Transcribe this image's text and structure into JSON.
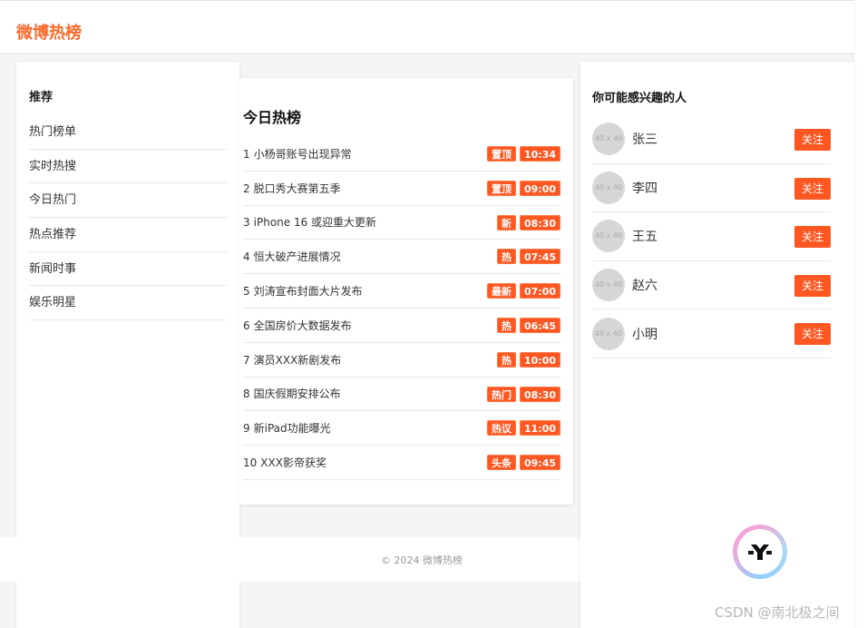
{
  "header": {
    "logo": "微博热榜"
  },
  "left": {
    "title": "推荐",
    "items": [
      "热门榜单",
      "实时热搜",
      "今日热门",
      "热点推荐",
      "新闻时事",
      "娱乐明星"
    ]
  },
  "center": {
    "title": "今日热榜",
    "items": [
      {
        "rank": "1",
        "text": "小杨哥账号出现异常",
        "tag": "置顶",
        "time": "10:34"
      },
      {
        "rank": "2",
        "text": "脱口秀大赛第五季",
        "tag": "置顶",
        "time": "09:00"
      },
      {
        "rank": "3",
        "text": "iPhone 16 或迎重大更新",
        "tag": "新",
        "time": "08:30"
      },
      {
        "rank": "4",
        "text": "恒大破产进展情况",
        "tag": "热",
        "time": "07:45"
      },
      {
        "rank": "5",
        "text": "刘涛宣布封面大片发布",
        "tag": "最新",
        "time": "07:00"
      },
      {
        "rank": "6",
        "text": "全国房价大数据发布",
        "tag": "热",
        "time": "06:45"
      },
      {
        "rank": "7",
        "text": "演员XXX新剧发布",
        "tag": "热",
        "time": "10:00"
      },
      {
        "rank": "8",
        "text": "国庆假期安排公布",
        "tag": "热门",
        "time": "08:30"
      },
      {
        "rank": "9",
        "text": "新iPad功能曝光",
        "tag": "热议",
        "time": "11:00"
      },
      {
        "rank": "10",
        "text": "XXX影帝获奖",
        "tag": "头条",
        "time": "09:45"
      }
    ]
  },
  "right": {
    "title": "你可能感兴趣的人",
    "avatar_placeholder": "40 x 40",
    "follow_label": "关注",
    "people": [
      "张三",
      "李四",
      "王五",
      "赵六",
      "小明"
    ]
  },
  "footer": {
    "copyright": "© 2024 微博热榜"
  },
  "watermark": "CSDN @南北极之间",
  "colors": {
    "brand": "#ff6a2a",
    "tag": "#ff5722"
  },
  "icons": {
    "fab": "y-logo-icon"
  }
}
